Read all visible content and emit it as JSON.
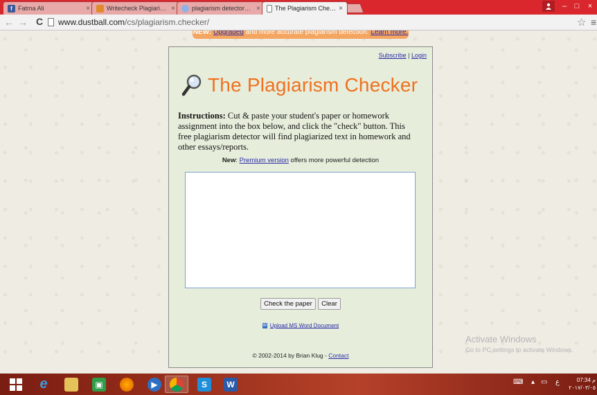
{
  "browser": {
    "tabs": [
      {
        "label": "Fatma Ali",
        "close": "×"
      },
      {
        "label": "Writecheck Plagiarism Che",
        "close": "×"
      },
      {
        "label": "plagiarism detectors - Doc",
        "close": "×"
      },
      {
        "label": "The Plagiarism Checker",
        "close": "×"
      }
    ],
    "url_domain": "www.dustball.com",
    "url_path": "/cs/plagiarism.checker/",
    "window_controls": {
      "minimize": "–",
      "maximize": "□",
      "close": "×"
    }
  },
  "banner": {
    "new_label": "NEW:",
    "link1": "Upgraded",
    "text": " and more accurate plagiarism detection. ",
    "link2": "Learn more."
  },
  "top_links": {
    "subscribe": "Subscribe",
    "separator": " | ",
    "login": "Login"
  },
  "title": "The Plagiarism Checker",
  "instructions": {
    "label": "Instructions:",
    "text": " Cut & paste your student's paper or homework assignment into the box below, and click the \"check\" button. This free plagiarism detector will find plagiarized text in homework and other essays/reports."
  },
  "premium": {
    "label": "New",
    "colon": ": ",
    "link": "Premium version",
    "text": " offers more powerful detection"
  },
  "buttons": {
    "check": "Check the paper",
    "clear": "Clear"
  },
  "upload_link": "Upload MS Word Document",
  "footer": {
    "copyright": "© 2002-2014 by Brian Klug - ",
    "contact": "Contact"
  },
  "watermark": {
    "line1": "Activate Windows",
    "line2": "Go to PC settings to activate Windows."
  },
  "taskbar": {
    "tray_lang": "ع",
    "clock_time": "07:34 م",
    "clock_date": "٢٠١٧/٠٣/٠٥"
  },
  "colors": {
    "title_orange": "#f07020",
    "link_blue": "#2a2aa8",
    "panel_bg": "#e6eedb",
    "chrome_red": "#d9272d"
  }
}
